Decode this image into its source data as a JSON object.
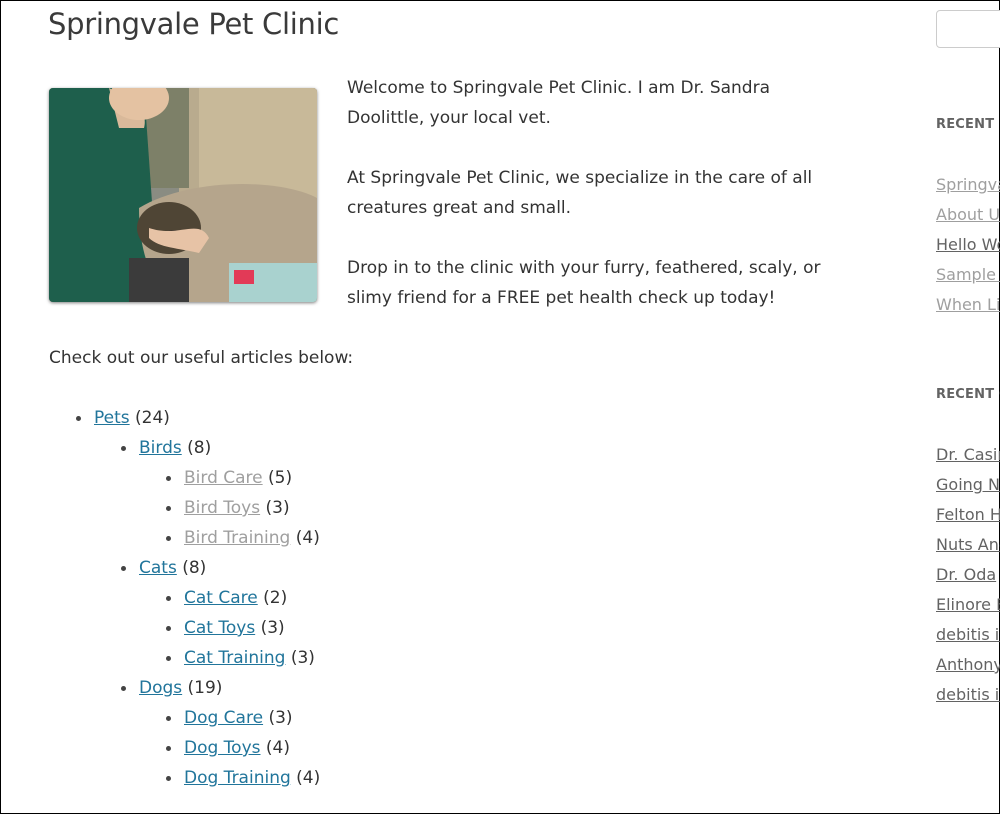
{
  "site": {
    "title": "Springvale Pet Clinic"
  },
  "photo": {
    "alt": "Veterinarians treating a German Shepherd on an exam table"
  },
  "intro": {
    "paragraphs": [
      "Welcome to Springvale Pet Clinic. I am Dr. Sandra Doolittle, your local vet.",
      "At Springvale Pet Clinic, we specialize in the care of all creatures great and small.",
      "Drop in to the clinic with your furry, feathered, scaly, or slimy friend for a FREE pet health check up today!"
    ]
  },
  "articles": {
    "label": "Check out our useful articles below:",
    "tree": {
      "name": "Pets",
      "count": "(24)",
      "children": [
        {
          "name": "Birds",
          "count": "(8)",
          "children": [
            {
              "name": "Bird Care",
              "count": "(5)",
              "visited": true
            },
            {
              "name": "Bird Toys",
              "count": "(3)",
              "visited": true
            },
            {
              "name": "Bird Training",
              "count": "(4)",
              "visited": true
            }
          ]
        },
        {
          "name": "Cats",
          "count": "(8)",
          "children": [
            {
              "name": "Cat Care",
              "count": "(2)"
            },
            {
              "name": "Cat Toys",
              "count": "(3)"
            },
            {
              "name": "Cat Training",
              "count": "(3)"
            }
          ]
        },
        {
          "name": "Dogs",
          "count": "(19)",
          "children": [
            {
              "name": "Dog Care",
              "count": "(3)"
            },
            {
              "name": "Dog Toys",
              "count": "(4)"
            },
            {
              "name": "Dog Training",
              "count": "(4)"
            }
          ]
        }
      ]
    }
  },
  "sidebar": {
    "search": {
      "placeholder": ""
    },
    "recent_posts": {
      "title": "RECENT P",
      "items": [
        {
          "label": "Springva",
          "visited": true
        },
        {
          "label": "About Us",
          "visited": true
        },
        {
          "label": "Hello Wo",
          "visited": false
        },
        {
          "label": "Sample P",
          "visited": true
        },
        {
          "label": "When Lif",
          "visited": true
        }
      ]
    },
    "recent_comments": {
      "title": "RECENT C",
      "items": [
        "Dr. Casin",
        "Going Nu",
        "Felton H",
        "Nuts And",
        "Dr. Oda",
        "Elinore E",
        "debitis id",
        "Anthony",
        "debitis id"
      ]
    }
  }
}
